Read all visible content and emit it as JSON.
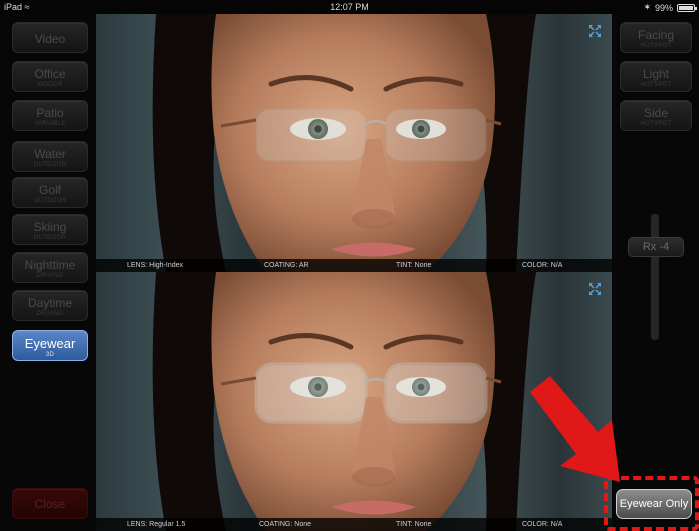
{
  "status_bar": {
    "device": "iPad",
    "time": "12:07 PM",
    "battery": "99%"
  },
  "left_panel": {
    "buttons": [
      {
        "label": "Video",
        "sub": ""
      },
      {
        "label": "Office",
        "sub": "INDOOR"
      },
      {
        "label": "Patio",
        "sub": "VARIABLE"
      },
      {
        "label": "Water",
        "sub": "OUTDOOR"
      },
      {
        "label": "Golf",
        "sub": "OUTDOOR"
      },
      {
        "label": "Skiing",
        "sub": "OUTDOOR"
      },
      {
        "label": "Nighttime",
        "sub": "DRIVING"
      },
      {
        "label": "Daytime",
        "sub": "DRIVING"
      },
      {
        "label": "Eyewear",
        "sub": "3D"
      }
    ],
    "active": "Eyewear",
    "close_label": "Close"
  },
  "right_panel": {
    "buttons": [
      {
        "label": "Facing",
        "sub": "HOTSPOT"
      },
      {
        "label": "Light",
        "sub": "HOTSPOT"
      },
      {
        "label": "Side",
        "sub": "HOTSPOT"
      }
    ],
    "rx_label": "Rx -4",
    "eyewear_only_label": "Eyewear Only"
  },
  "top_view": {
    "lens": "LENS: High-Index",
    "coating": "COATING: AR",
    "tint": "TINT: None",
    "color": "COLOR: N/A"
  },
  "bottom_view": {
    "lens": "LENS: Regular 1.5",
    "coating": "COATING: None",
    "tint": "TINT: None",
    "color": "COLOR: N/A"
  },
  "colors": {
    "active_button": "#3f6fb2",
    "close_button": "#2a0606",
    "arrow": "#e01818",
    "dashed_highlight": "#e01818"
  },
  "icons": {
    "expand": "expand-arrows-icon",
    "wifi": "wifi-icon",
    "bluetooth": "bluetooth-icon",
    "battery": "battery-icon"
  }
}
